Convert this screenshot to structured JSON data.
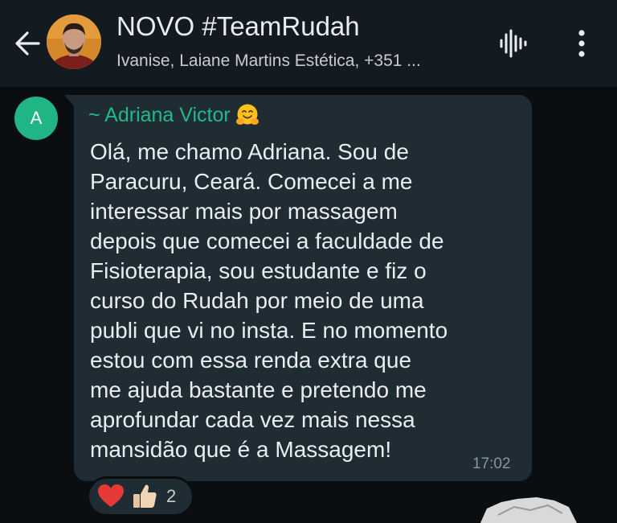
{
  "header": {
    "back_icon": "arrow-left-icon",
    "title": "NOVO #TeamRudah",
    "subtitle": "Ivanise, Laiane Martins Estética, +351 ...",
    "voice_icon": "audio-waveform-icon",
    "menu_icon": "more-vertical-icon"
  },
  "message": {
    "avatar_initial": "A",
    "sender_name": "~ Adriana Victor",
    "sender_emoji": "hugging-face-emoji",
    "text": "Olá, me chamo Adriana. Sou de\nParacuru, Ceará. Comecei a me\ninteressar mais por massagem\ndepois que comecei a faculdade de\nFisioterapia, sou estudante e fiz o\ncurso do Rudah por meio de uma\npubli que vi no insta. E no momento\nestou com essa renda extra que\nme ajuda bastante e pretendo me\naprofundar cada vez mais nessa\nmansidão que é a Massagem!",
    "time": "17:02",
    "reactions": {
      "emojis": [
        "red-heart-emoji",
        "thumbs-up-emoji"
      ],
      "count": "2"
    }
  },
  "colors": {
    "header_bg": "#141b20",
    "chat_bg": "#0b0e11",
    "bubble_bg": "#1f2c34",
    "sender_name": "#20b98a",
    "avatar_bg": "#1fb584",
    "timestamp": "#8696a0"
  }
}
